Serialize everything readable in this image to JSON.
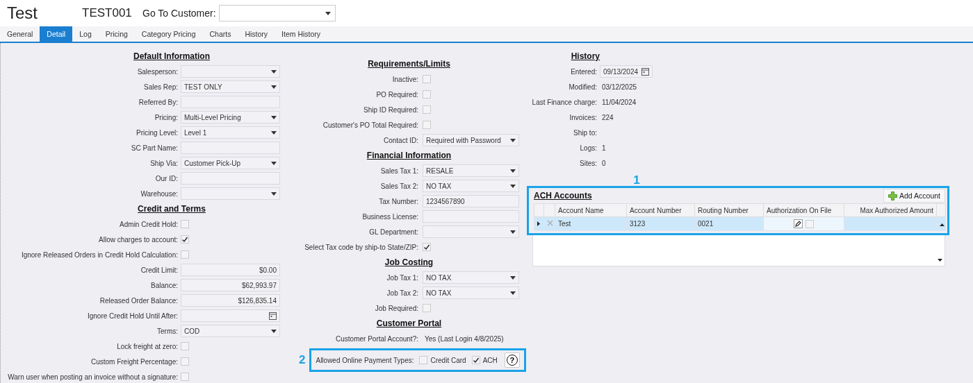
{
  "header": {
    "title": "Test",
    "code": "TEST001",
    "goto_label": "Go To Customer:"
  },
  "tabs": [
    {
      "label": "General",
      "selected": false
    },
    {
      "label": "Detail",
      "selected": true
    },
    {
      "label": "Log",
      "selected": false
    },
    {
      "label": "Pricing",
      "selected": false
    },
    {
      "label": "Category Pricing",
      "selected": false
    },
    {
      "label": "Charts",
      "selected": false
    },
    {
      "label": "History",
      "selected": false
    },
    {
      "label": "Item History",
      "selected": false
    }
  ],
  "left_sections": [
    {
      "title": "Default Information",
      "rows": [
        {
          "kind": "select",
          "label": "Salesperson:"
        },
        {
          "kind": "select",
          "label": "Sales Rep:",
          "value": "TEST ONLY"
        },
        {
          "kind": "text",
          "label": "Referred By:"
        },
        {
          "kind": "select",
          "label": "Pricing:",
          "value": "Multi-Level Pricing"
        },
        {
          "kind": "select",
          "label": "Pricing Level:",
          "value": "Level 1"
        },
        {
          "kind": "text",
          "label": "SC Part Name:"
        },
        {
          "kind": "select",
          "label": "Ship Via:",
          "value": "Customer Pick-Up"
        },
        {
          "kind": "text",
          "label": "Our ID:"
        },
        {
          "kind": "select",
          "label": "Warehouse:"
        }
      ]
    },
    {
      "title": "Credit and Terms",
      "rows": [
        {
          "kind": "check",
          "label": "Admin Credit Hold:",
          "checked": false
        },
        {
          "kind": "check",
          "label": "Allow charges to account:",
          "checked": true
        },
        {
          "kind": "check",
          "label": "Ignore Released Orders in Credit Hold Calculation:",
          "checked": false
        },
        {
          "kind": "money",
          "label": "Credit Limit:",
          "value": "$0.00"
        },
        {
          "kind": "money",
          "label": "Balance:",
          "value": "$62,993.97"
        },
        {
          "kind": "money",
          "label": "Released Order Balance:",
          "value": "$126,835.14"
        },
        {
          "kind": "date",
          "label": "Ignore Credit Hold Until After:"
        },
        {
          "kind": "select",
          "label": "Terms:",
          "value": "COD"
        },
        {
          "kind": "check",
          "label": "Lock freight at zero:",
          "checked": false
        },
        {
          "kind": "check",
          "label": "Custom Freight Percentage:",
          "checked": false
        },
        {
          "kind": "check",
          "label": "Warn user when posting an invoice without a signature:",
          "checked": false
        }
      ]
    }
  ],
  "middle_sections": [
    {
      "title": "Requirements/Limits",
      "rows": [
        {
          "kind": "check",
          "label": "Inactive:",
          "checked": false
        },
        {
          "kind": "check",
          "label": "PO Required:",
          "checked": false
        },
        {
          "kind": "check",
          "label": "Ship ID Required:",
          "checked": false
        },
        {
          "kind": "check",
          "label": "Customer's PO Total Required:",
          "checked": false
        },
        {
          "kind": "select",
          "label": "Contact ID:",
          "value": "Required with Password"
        }
      ]
    },
    {
      "title": "Financial Information",
      "rows": [
        {
          "kind": "select",
          "label": "Sales Tax 1:",
          "value": "RESALE"
        },
        {
          "kind": "select",
          "label": "Sales Tax 2:",
          "value": "NO TAX"
        },
        {
          "kind": "text",
          "label": "Tax Number:",
          "value": "1234567890"
        },
        {
          "kind": "text",
          "label": "Business License:"
        },
        {
          "kind": "select",
          "label": "GL Department:"
        },
        {
          "kind": "check",
          "label": "Select Tax code by ship-to State/ZIP:",
          "checked": true
        }
      ]
    },
    {
      "title": "Job Costing",
      "rows": [
        {
          "kind": "select",
          "label": "Job Tax 1:",
          "value": "NO TAX"
        },
        {
          "kind": "select",
          "label": "Job Tax 2:",
          "value": "NO TAX"
        },
        {
          "kind": "check",
          "label": "Job Required:",
          "checked": false
        }
      ]
    },
    {
      "title": "Customer Portal",
      "rows": [
        {
          "kind": "static",
          "label": "Customer Portal Account?:",
          "value": "Yes (Last Login 4/8/2025)"
        },
        {
          "kind": "payment",
          "callout": "2",
          "label": "Allowed Online Payment Types:",
          "options": [
            {
              "label": "Credit Card",
              "checked": false
            },
            {
              "label": "ACH",
              "checked": true
            }
          ],
          "help": "?"
        }
      ]
    }
  ],
  "history": {
    "title": "History",
    "rows": [
      {
        "kind": "date",
        "label": "Entered:",
        "value": "09/13/2024"
      },
      {
        "kind": "static",
        "label": "Modified:",
        "value": "03/12/2025"
      },
      {
        "kind": "static",
        "label": "Last Finance charge:",
        "value": "11/04/2024"
      },
      {
        "kind": "static",
        "label": "Invoices:",
        "value": "224"
      },
      {
        "kind": "static",
        "label": "Ship to:"
      },
      {
        "kind": "static",
        "label": "Logs:",
        "value": "1"
      },
      {
        "kind": "static",
        "label": "Sites:",
        "value": "0"
      }
    ]
  },
  "ach": {
    "callout": "1",
    "title": "ACH Accounts",
    "add_button": "Add Account",
    "columns": [
      "Account Name",
      "Account Number",
      "Routing Number",
      "Authorization On File",
      "Max Authorized Amount"
    ],
    "rows": [
      {
        "selected": true,
        "account_name": "Test",
        "account_number": "3123",
        "routing_number": "0021",
        "authorization_on_file": false
      }
    ]
  }
}
